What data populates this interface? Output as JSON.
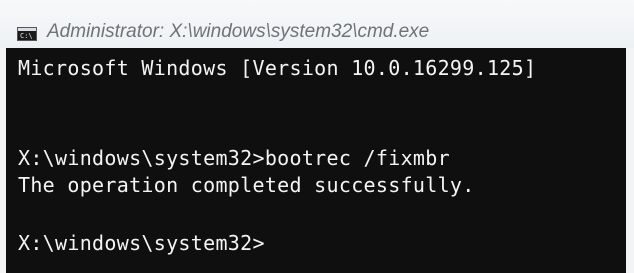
{
  "window": {
    "title": "Administrator: X:\\windows\\system32\\cmd.exe",
    "icon": "cmd-icon"
  },
  "console": {
    "lines": [
      "Microsoft Windows [Version 10.0.16299.125]",
      "X:\\windows\\system32>bootrec /fixmbr",
      "The operation completed successfully.",
      "X:\\windows\\system32>"
    ]
  },
  "colors": {
    "console_background": "#0f0f10",
    "console_text": "#f4f4f4",
    "title_text": "#6f7378",
    "titlebar_background": "#f2f4f6"
  }
}
